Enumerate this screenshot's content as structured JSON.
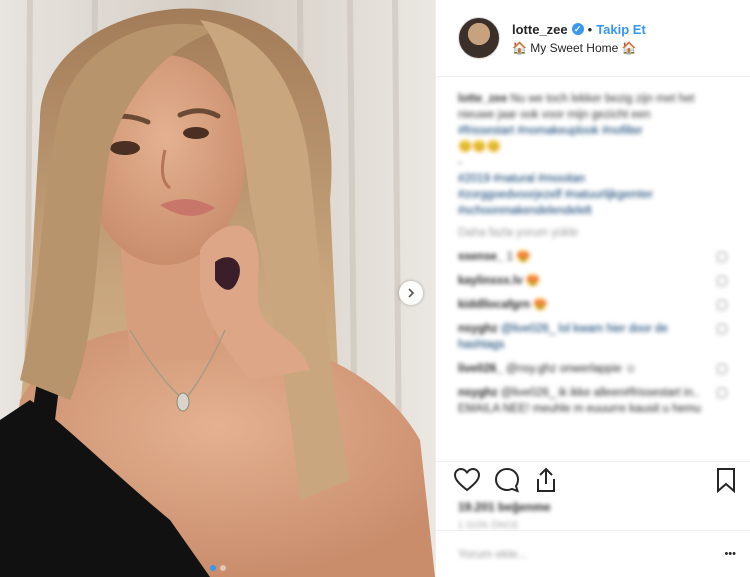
{
  "post": {
    "username": "lotte_zee",
    "verified_icon": "verified-badge-icon",
    "separator": "•",
    "follow_label": "Takip Et",
    "location": "🏠 My Sweet Home 🏠",
    "caption": {
      "user": "lotte_zee",
      "text": "Nu we toch lekker bezig zijn met het nieuwe jaar ook voor mijn gezicht een",
      "tags_line1": "#frissestart #nomakeuplook #nofilter",
      "emojis": "😊😊😊",
      "dash": "-",
      "tags_line2": "#2019 #natural #mooitan",
      "tags_line3": "#zorggoedvoorjezelf #natuurlijkgemter",
      "tags_line4": "#schoonmakendelendelelt"
    },
    "load_more": "Daha fazla yorum yükle",
    "comments": [
      {
        "user": "ssense_",
        "text": "1 😍"
      },
      {
        "user": "kaylinxxx.lv",
        "text": "😍"
      },
      {
        "user": "kiddllocafgrn",
        "text": "😍"
      },
      {
        "user": "nsyghz",
        "text": "@live026_ lol kwam hier door de hashtags"
      },
      {
        "user": "live026_",
        "text": "@nsy.ghz onwerlappie ☺"
      },
      {
        "user": "nsyghz",
        "text": "@live026_ ik ikke alleen#frissestart in.. EMAILA NEE! meuhle m euuurre kausit u hemu"
      }
    ],
    "likes": "19.201 beğenme",
    "date": "1 gün önce",
    "add_comment_placeholder": "Yorum ekle...",
    "more_label": "•••",
    "colors": {
      "accent": "#3897f0",
      "text": "#262626",
      "muted": "#999999",
      "hashtag": "#003569"
    }
  }
}
